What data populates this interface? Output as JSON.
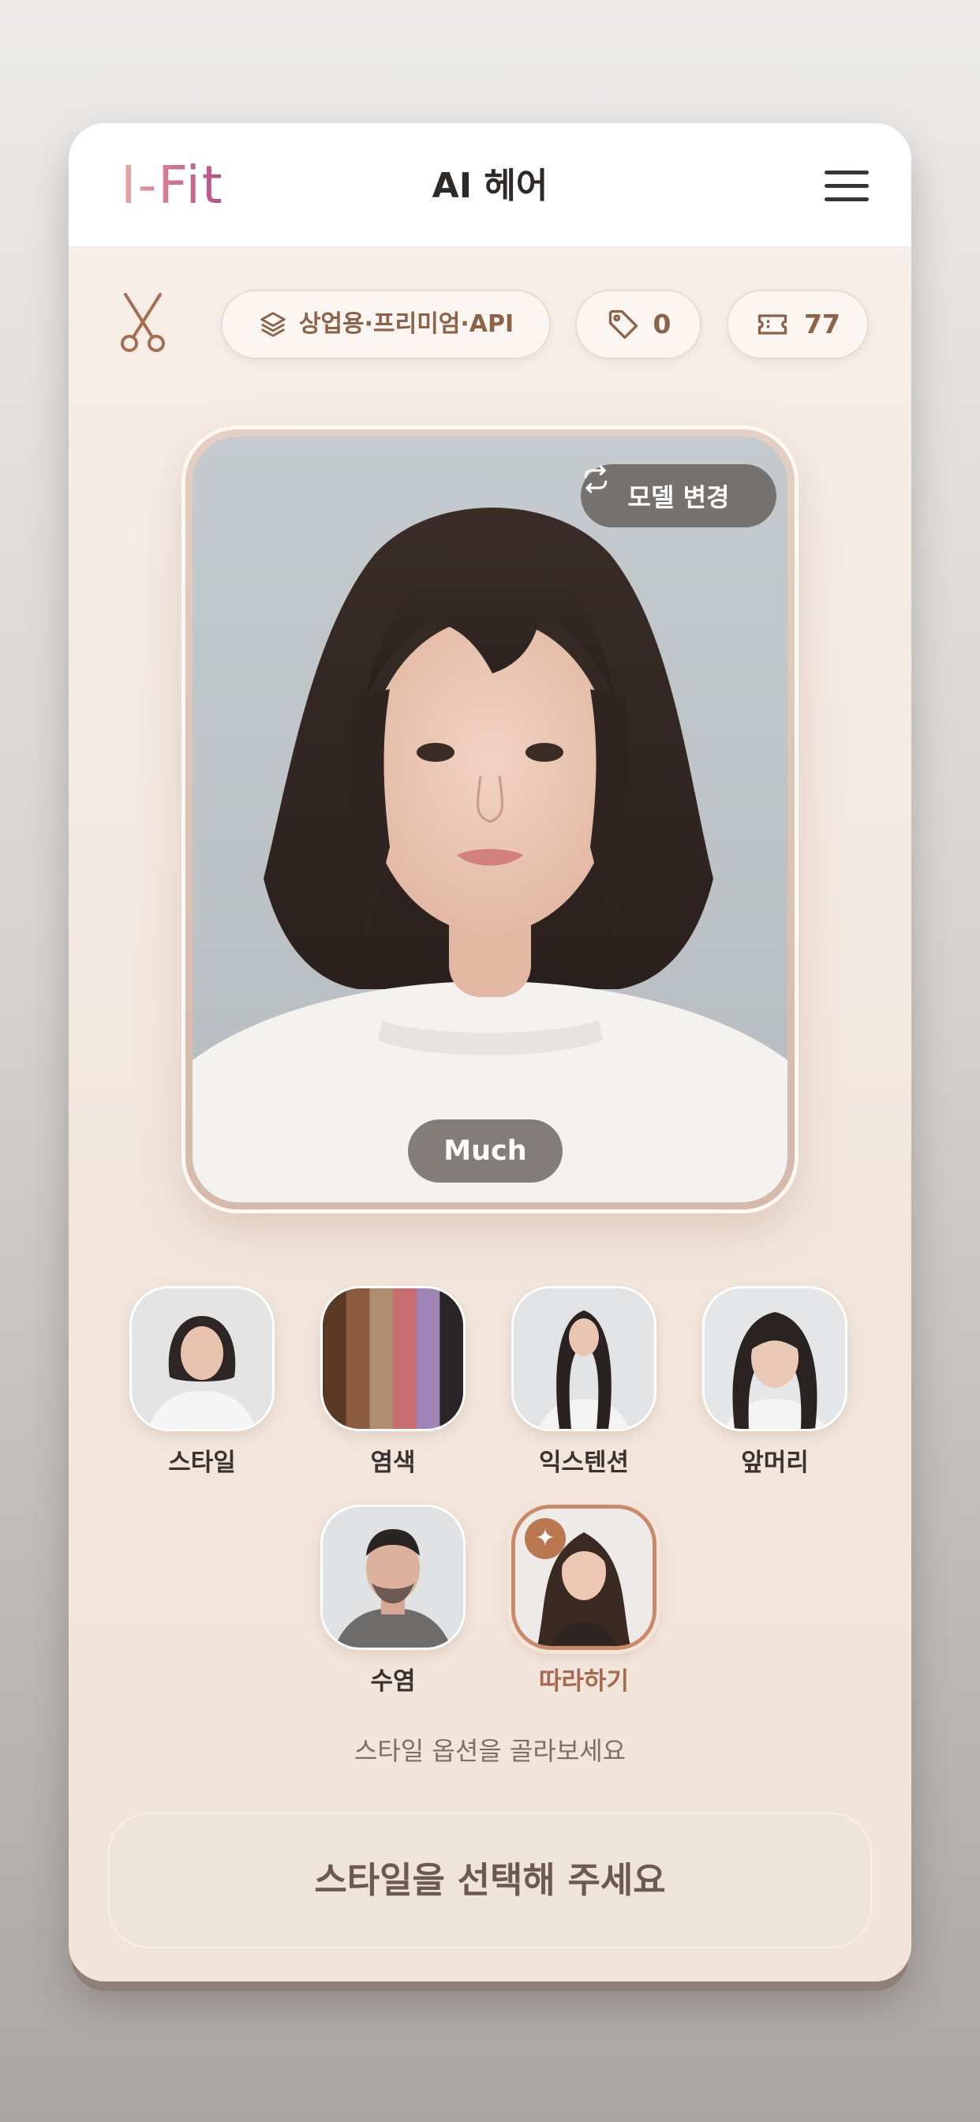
{
  "app": {
    "logo": "I-Fit",
    "title": "AI 헤어"
  },
  "toolbar": {
    "plan_label": "상업용·프리미엄·API",
    "tag_count": "0",
    "ticket_count": "77"
  },
  "preview": {
    "change_model_label": "모델 변경",
    "style_name": "Much"
  },
  "options": [
    {
      "label": "스타일"
    },
    {
      "label": "염색"
    },
    {
      "label": "익스텐션"
    },
    {
      "label": "앞머리"
    },
    {
      "label": "수염"
    },
    {
      "label": "따라하기",
      "selected": true
    }
  ],
  "dye_swatches": [
    "#5b3a25",
    "#8a5c3d",
    "#b08e72",
    "#c96e70",
    "#a184b6",
    "#2a2628"
  ],
  "hint": "스타일 옵션을 골라보세요",
  "cta_label": "스타일을 선택해 주세요",
  "colors": {
    "accent": "#a46a54",
    "brand_pink": "#c05a86",
    "cta_bg": "#efe4d9"
  }
}
